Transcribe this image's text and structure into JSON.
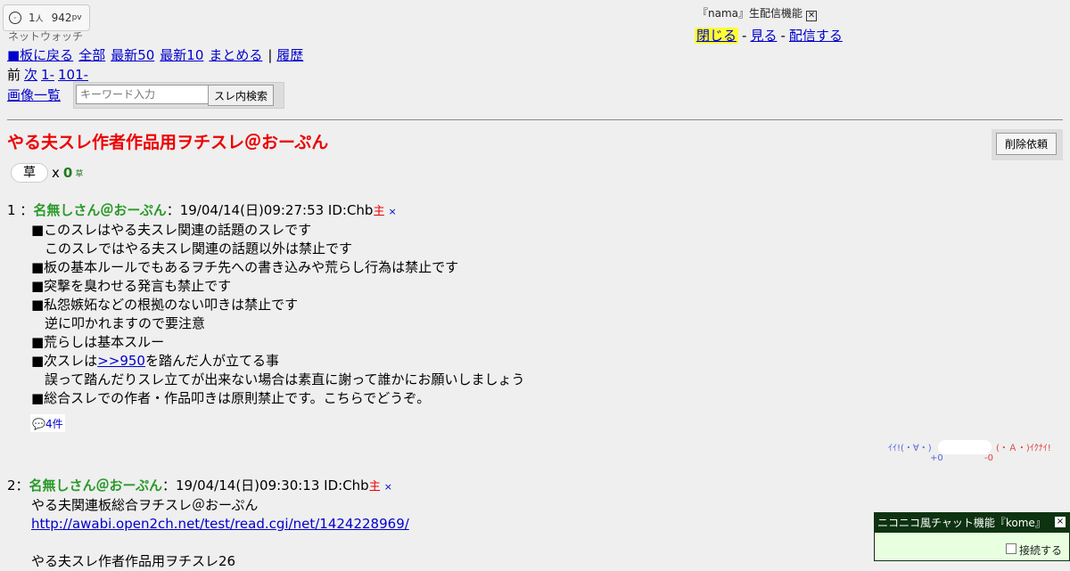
{
  "viewer": {
    "count": "1",
    "unit": "人",
    "pv": "942",
    "pv_unit": "pv"
  },
  "watch_label": "ネットウォッチ",
  "nav": {
    "back": "■板に戻る",
    "all": "全部",
    "latest50": "最新50",
    "latest10": "最新10",
    "summarize": "まとめる",
    "separator": "|",
    "history": "履歴",
    "prev": "前",
    "next": "次",
    "range1": "1-",
    "range101": "101-",
    "image_list": "画像一覧"
  },
  "search": {
    "placeholder": "キーワード入力",
    "button": "スレ内検索"
  },
  "nama": {
    "label": "『nama』生配信機能",
    "close": "閉じる",
    "watch": "見る",
    "broadcast": "配信する",
    "sep": "-"
  },
  "thread": {
    "title": "やる夫スレ作者作品用ヲチスレ＠おーぷん",
    "delete_button": "削除依頼"
  },
  "kusa": {
    "label": "草",
    "x": "x",
    "count": "0",
    "unit": "草"
  },
  "posts": [
    {
      "num": "1 ：",
      "name": "名無しさん＠おーぷん",
      "meta": "：19/04/14(日)09:27:53 ID:Chb",
      "owner": "主",
      "del": "×",
      "lines": [
        "■このスレはやる夫スレ関連の話題のスレです",
        "　このスレではやる夫スレ関連の話題以外は禁止です",
        "■板の基本ルールでもあるヲチ先への書き込みや荒らし行為は禁止です",
        "■突撃を臭わせる発言も禁止です",
        "■私怨嫉妬などの根拠のない叩きは禁止です",
        "　逆に叩かれますので要注意",
        "■荒らしは基本スルー"
      ],
      "anchor_line": {
        "prefix": "■次スレは",
        "anchor": ">>950",
        "suffix": "を踏んだ人が立てる事"
      },
      "lines_after": [
        "　誤って踏んだりスレ立てが出来ない場合は素直に謝って誰かにお願いしましょう",
        "■総合スレでの作者・作品叩きは原則禁止です。こちらでどうぞ。"
      ],
      "reply_count": "4件"
    },
    {
      "num": "2：",
      "name": "名無しさん＠おーぷん",
      "meta": "：19/04/14(日)09:30:13 ID:Chb",
      "owner": "主",
      "del": "×",
      "line1": "やる夫関連板総合ヲチスレ＠おーぷん",
      "link": "http://awabi.open2ch.net/test/read.cgi/net/1424228969/",
      "line3": "やる夫スレ作者作品用ヲチスレ26"
    }
  ],
  "votes": {
    "good_label": "ｲｲ!(・∀・)",
    "bad_label": "(・Ａ・)ｲｸﾅｲ!",
    "good_count": "+0",
    "bad_count": "-0"
  },
  "kome": {
    "title": "ニコニコ風チャット機能『kome』",
    "close": "×",
    "connect_label": "接続する"
  },
  "colors": {
    "title_red": "#ee0000",
    "name_green": "#2a9a2a",
    "link_blue": "#0000cc",
    "kome_header": "#0d3310",
    "highlight_yellow": "#ffff33"
  }
}
